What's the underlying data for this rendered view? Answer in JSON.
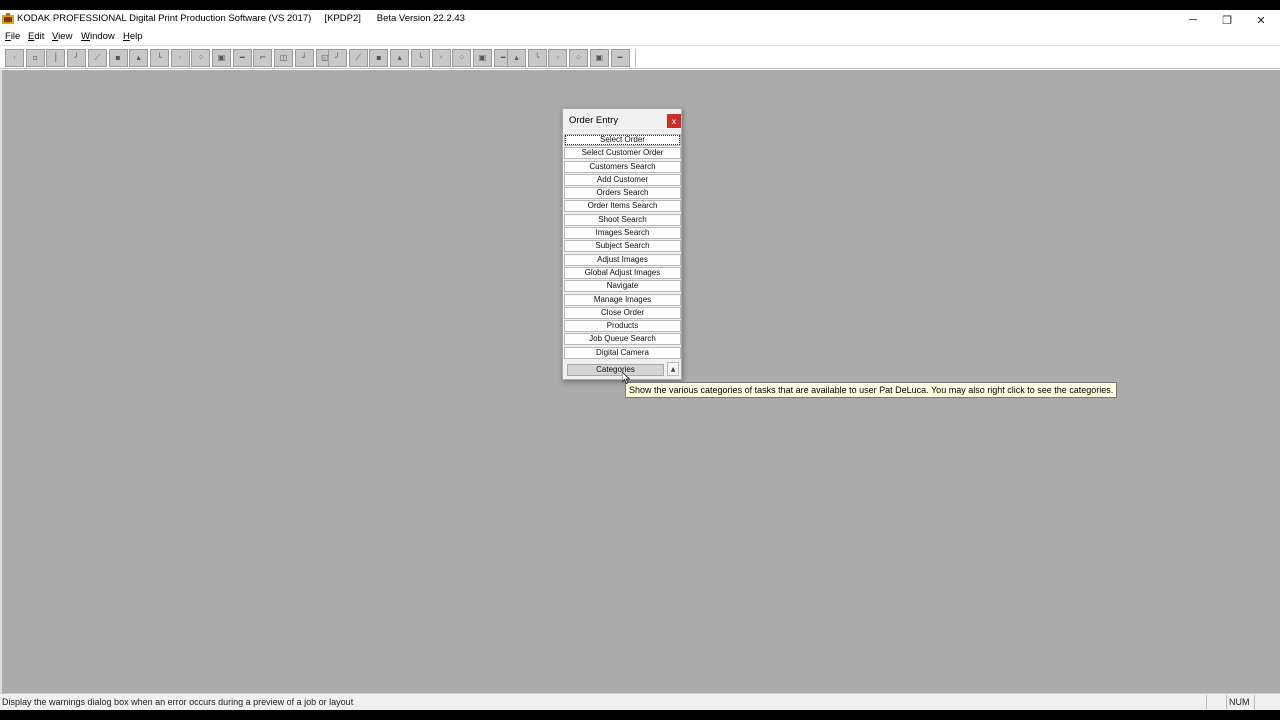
{
  "window": {
    "title": "KODAK PROFESSIONAL Digital Print Production Software (VS 2017)     [KPDP2]      Beta Version 22.2.43",
    "minimize_glyph": "─",
    "maximize_glyph": "❐",
    "close_glyph": "✕"
  },
  "menu": [
    "File",
    "Edit",
    "View",
    "Window",
    "Help"
  ],
  "toolbar": {
    "group1": [
      "",
      "",
      "",
      "",
      "",
      "",
      "",
      "",
      "",
      "",
      "",
      "",
      "",
      "",
      "",
      ""
    ],
    "group2": [
      "",
      "",
      "",
      "",
      "",
      "",
      "",
      "",
      ""
    ],
    "group3": [
      "",
      "",
      "",
      "",
      "",
      ""
    ]
  },
  "dialog": {
    "title": "Order Entry",
    "close_label": "x",
    "buttons": [
      "Select Order",
      "Select Customer Order",
      "Customers Search",
      "Add Customer",
      "Orders Search",
      "Order Items Search",
      "Shoot Search",
      "Images Search",
      "Subject Search",
      "Adjust Images",
      "Global Adjust Images",
      "Navigate",
      "Manage Images",
      "Close Order",
      "Products",
      "Job Queue Search",
      "Digital Camera"
    ],
    "categories_label": "Categories",
    "scroll_glyph": "▲"
  },
  "tooltip": "Show the various categories of tasks that are available to user Pat DeLuca.  You may also right click to see the categories.",
  "status": {
    "message": "Display the warnings dialog box when an error occurs during a preview of a job or layout",
    "num": "NUM"
  },
  "colors": {
    "workspace": "#ababab",
    "close_button": "#c9302c",
    "tooltip_bg": "#ffffe1"
  }
}
